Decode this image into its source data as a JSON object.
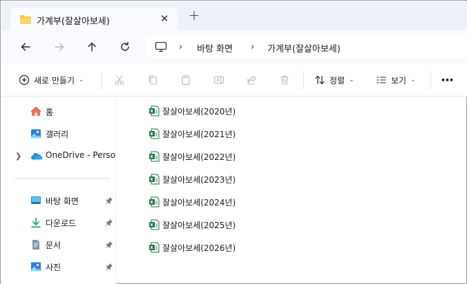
{
  "tab": {
    "title": "가계부(잘살아보세)",
    "close": "✕",
    "new_tab": "+"
  },
  "address": {
    "crumbs": [
      "바탕 화면",
      "가계부(잘살아보세)"
    ],
    "sep": "›"
  },
  "commands": {
    "new_label": "새로 만들기",
    "sort_label": "정렬",
    "view_label": "보기",
    "more": "•••"
  },
  "sidebar": {
    "items": [
      {
        "label": "홈",
        "icon": "home-icon"
      },
      {
        "label": "갤러리",
        "icon": "gallery-icon"
      },
      {
        "label": "OneDrive - Personal",
        "icon": "onedrive-icon"
      },
      {
        "label": "바탕 화면",
        "icon": "desktop-icon"
      },
      {
        "label": "다운로드",
        "icon": "download-icon"
      },
      {
        "label": "문서",
        "icon": "documents-icon"
      },
      {
        "label": "사진",
        "icon": "pictures-icon"
      }
    ]
  },
  "files": [
    {
      "name": "잘살아보세(2020년)"
    },
    {
      "name": "잘살아보세(2021년)"
    },
    {
      "name": "잘살아보세(2022년)"
    },
    {
      "name": "잘살아보세(2023년)"
    },
    {
      "name": "잘살아보세(2024년)"
    },
    {
      "name": "잘살아보세(2025년)"
    },
    {
      "name": "잘살아보세(2026년)"
    }
  ],
  "colors": {
    "accent": "#0067c0",
    "excel": "#1d7245",
    "folder": "#f8c44c",
    "tab_strip": "#eef2f8"
  }
}
